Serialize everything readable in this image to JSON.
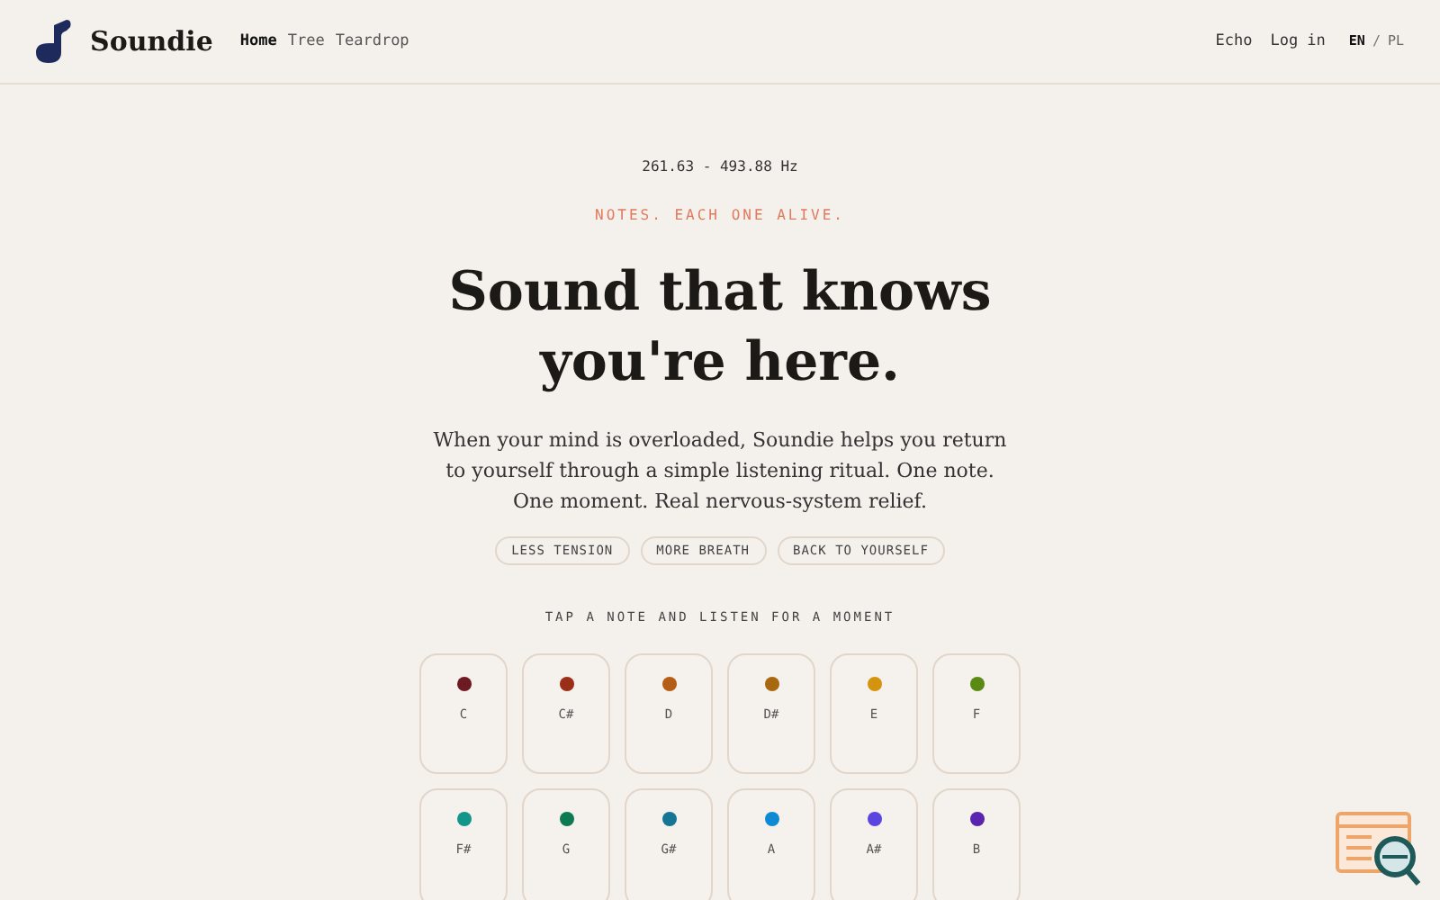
{
  "brand": {
    "name": "Soundie"
  },
  "nav": [
    {
      "label": "Home",
      "selected": true
    },
    {
      "label": "Tree",
      "selected": false
    },
    {
      "label": "Teardrop",
      "selected": false
    }
  ],
  "header_links": [
    "Echo",
    "Log in"
  ],
  "languages": [
    {
      "label": "EN",
      "selected": true
    },
    {
      "label": "PL",
      "selected": false
    }
  ],
  "language_separator": "/",
  "hero": {
    "range": "261.63 - 493.88 Hz",
    "eyebrow": "NOTES. EACH ONE ALIVE.",
    "title_lines": [
      "Sound that knows",
      "you're here."
    ],
    "body": "When your mind is overloaded, Soundie helps you return to yourself through a simple listening ritual. One note. One moment. Real nervous-system relief."
  },
  "chips": [
    "LESS TENSION",
    "MORE BREATH",
    "BACK TO YOURSELF"
  ],
  "notes_label": "TAP A NOTE AND LISTEN FOR A MOMENT",
  "notes": [
    {
      "name": "C",
      "color": "#6e1a22"
    },
    {
      "name": "C#",
      "color": "#9a2e17"
    },
    {
      "name": "D",
      "color": "#b35e14"
    },
    {
      "name": "D#",
      "color": "#a8680f"
    },
    {
      "name": "E",
      "color": "#d4940f"
    },
    {
      "name": "F",
      "color": "#5a8a14"
    },
    {
      "name": "F#",
      "color": "#14958a"
    },
    {
      "name": "G",
      "color": "#0e7a52"
    },
    {
      "name": "G#",
      "color": "#147694"
    },
    {
      "name": "A",
      "color": "#0e8ad4"
    },
    {
      "name": "A#",
      "color": "#5b45e0"
    },
    {
      "name": "B",
      "color": "#5a23b0"
    }
  ]
}
